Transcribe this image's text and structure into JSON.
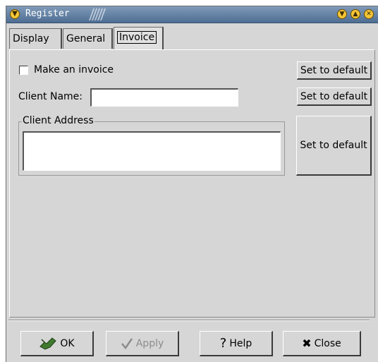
{
  "window": {
    "title": "Register",
    "controls": [
      "minimize-icon",
      "maximize-icon",
      "close-icon"
    ]
  },
  "tabs": [
    {
      "label": "Display",
      "active": false
    },
    {
      "label": "General",
      "active": false
    },
    {
      "label": "Invoice",
      "active": true
    }
  ],
  "invoice": {
    "make_invoice_label": "Make an invoice",
    "make_invoice_checked": false,
    "client_name_label": "Client Name:",
    "client_name_value": "",
    "client_address_label": "Client Address",
    "client_address_value": "",
    "set_default_label": "Set to default"
  },
  "buttons": {
    "ok": "OK",
    "apply": "Apply",
    "help": "Help",
    "close": "Close"
  },
  "colors": {
    "window_bg": "#d6d6d6",
    "titlebar": "#4e6d93",
    "title_buttons": "#f5c638"
  }
}
